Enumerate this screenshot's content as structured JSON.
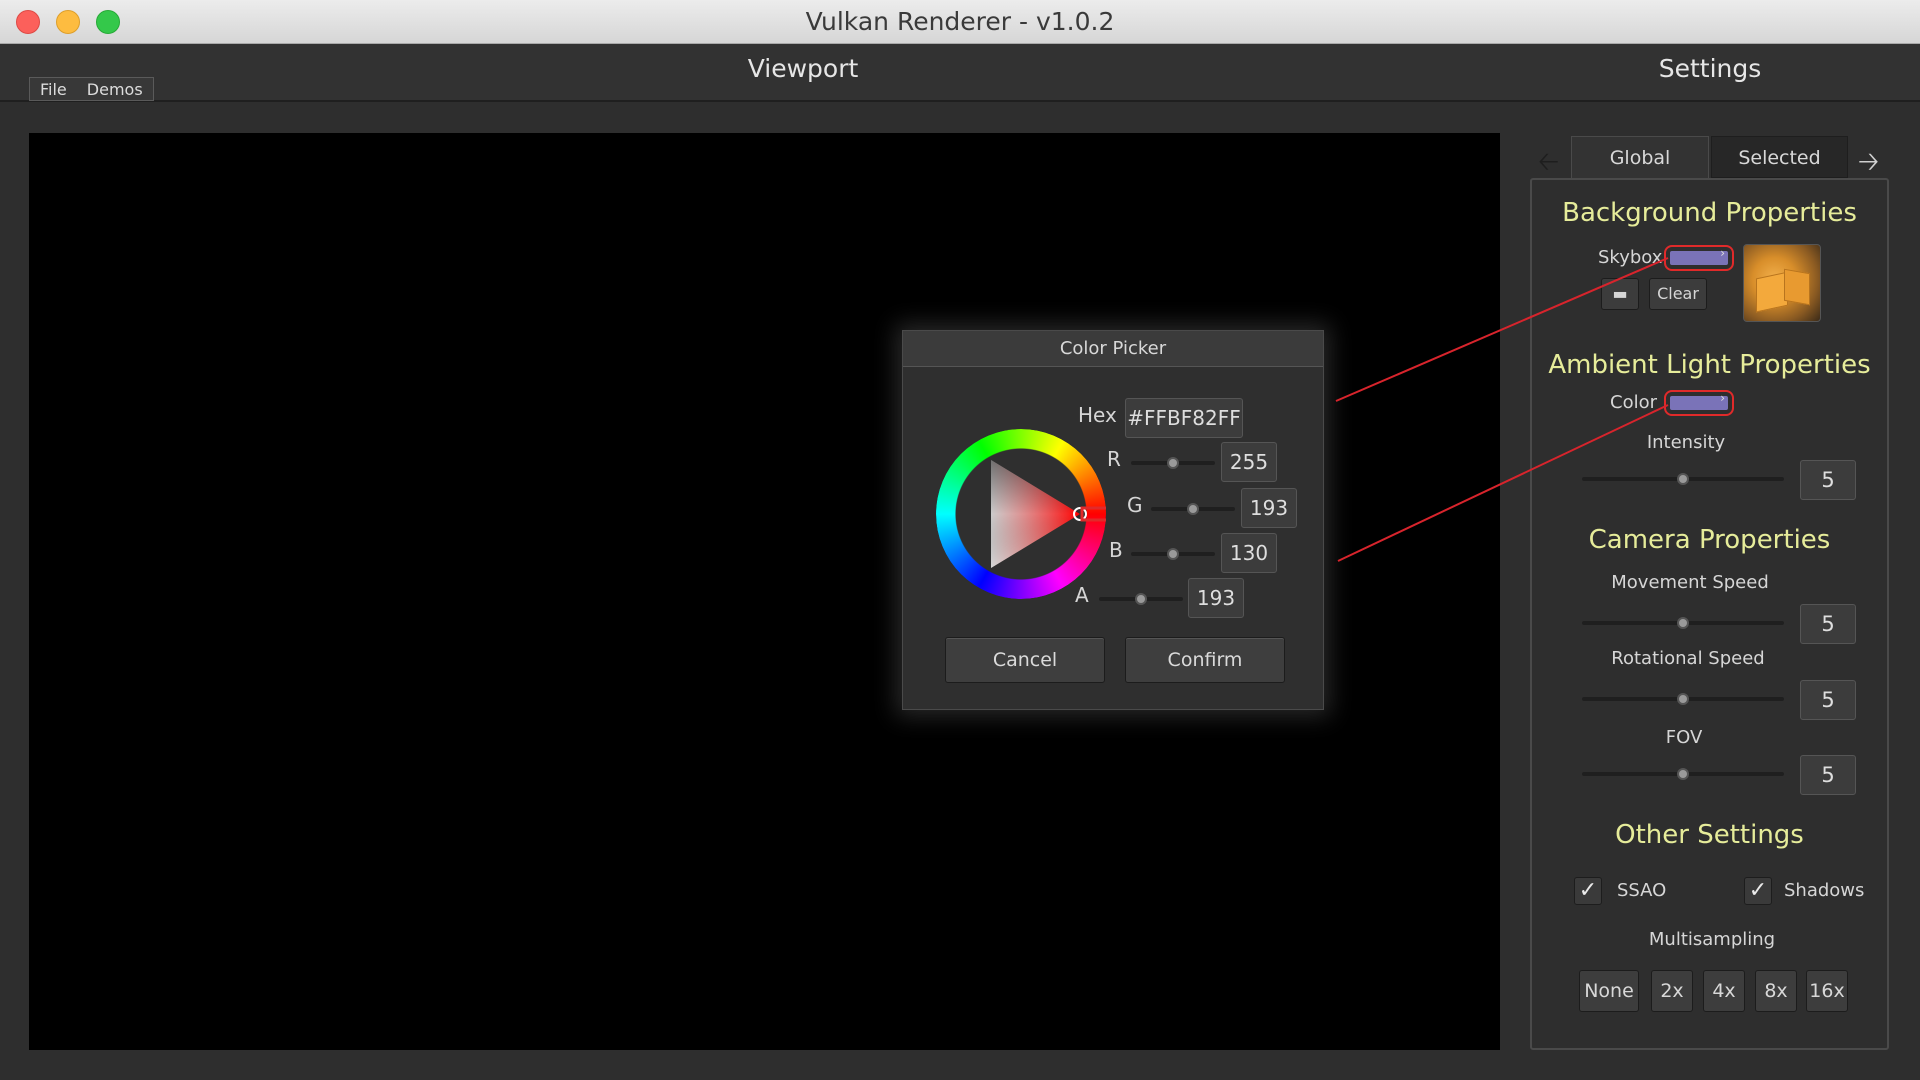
{
  "window": {
    "title": "Vulkan Renderer - v1.0.2"
  },
  "header": {
    "viewport_title": "Viewport",
    "settings_title": "Settings"
  },
  "menu": [
    {
      "label": "File"
    },
    {
      "label": "Demos"
    }
  ],
  "color_picker": {
    "title": "Color Picker",
    "hex_label": "Hex",
    "hex_value": "#FFBF82FF",
    "channels": [
      {
        "label": "R",
        "value": "255",
        "level": 0.5
      },
      {
        "label": "G",
        "value": "193",
        "level": 0.5
      },
      {
        "label": "B",
        "value": "130",
        "level": 0.5
      },
      {
        "label": "A",
        "value": "193",
        "level": 0.5
      }
    ],
    "cancel_label": "Cancel",
    "confirm_label": "Confirm"
  },
  "settings": {
    "tabs": [
      {
        "label": "Global",
        "active": true
      },
      {
        "label": "Selected",
        "active": false
      }
    ],
    "background": {
      "title": "Background Properties",
      "skybox_label": "Skybox",
      "clear_label": "Clear",
      "folder_icon": "folder-icon",
      "swatch_color": "#7a73b8"
    },
    "ambient": {
      "title": "Ambient Light Properties",
      "color_label": "Color",
      "intensity_label": "Intensity",
      "intensity_value": "5",
      "swatch_color": "#7a73b8"
    },
    "camera": {
      "title": "Camera Properties",
      "movement_label": "Movement Speed",
      "movement_value": "5",
      "rotational_label": "Rotational Speed",
      "rotational_value": "5",
      "fov_label": "FOV",
      "fov_value": "5"
    },
    "other": {
      "title": "Other Settings",
      "ssao_label": "SSAO",
      "ssao_checked": true,
      "shadows_label": "Shadows",
      "shadows_checked": true,
      "multisampling_label": "Multisampling",
      "multisampling_options": [
        "None",
        "2x",
        "4x",
        "8x",
        "16x"
      ]
    }
  },
  "colors": {
    "accent_title": "#e6ec9a",
    "highlight_red": "#e02a2a"
  }
}
